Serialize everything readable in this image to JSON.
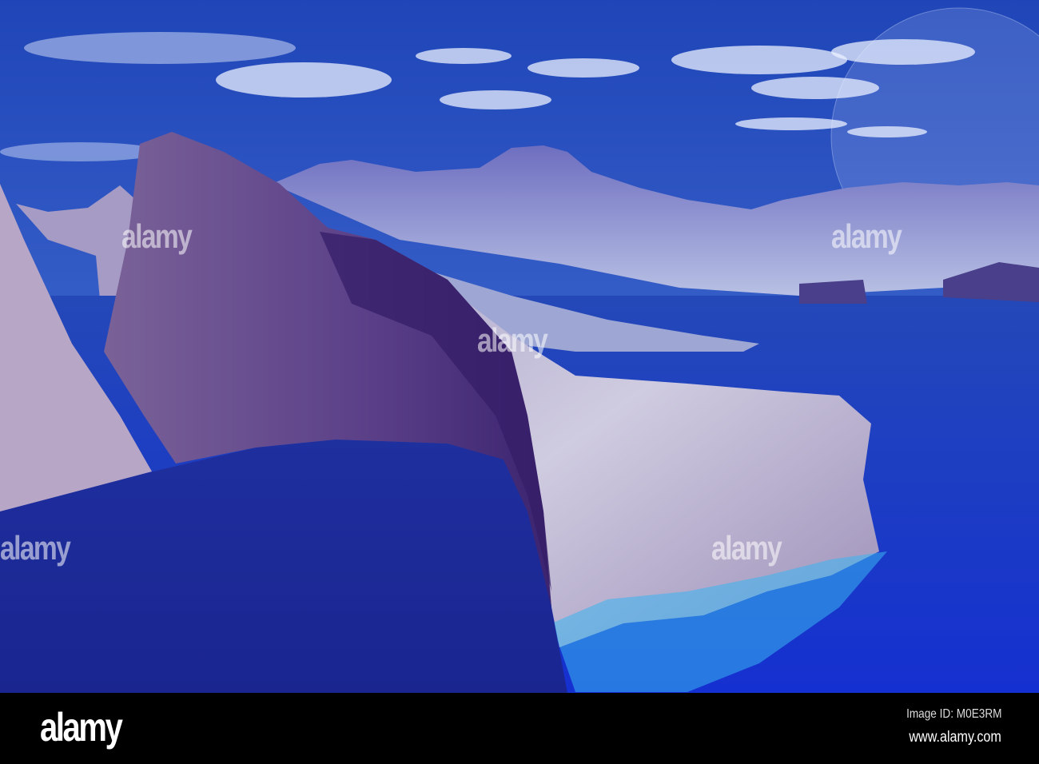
{
  "image": {
    "colors": {
      "sky_top": "#1f45b8",
      "sky_horizon": "#7d99de",
      "water_dark": "#1a2794",
      "water_bright": "#1838c8",
      "rock_light": "#c9c6de",
      "cliff_shadow": "#4a2f7a",
      "mountain_back": "#7b7cc6",
      "shore": "#38b4f2"
    }
  },
  "watermark": {
    "text": "alamy"
  },
  "footer": {
    "logo": "alamy",
    "image_id": "Image ID: M0E3RM",
    "url": "www.alamy.com"
  }
}
